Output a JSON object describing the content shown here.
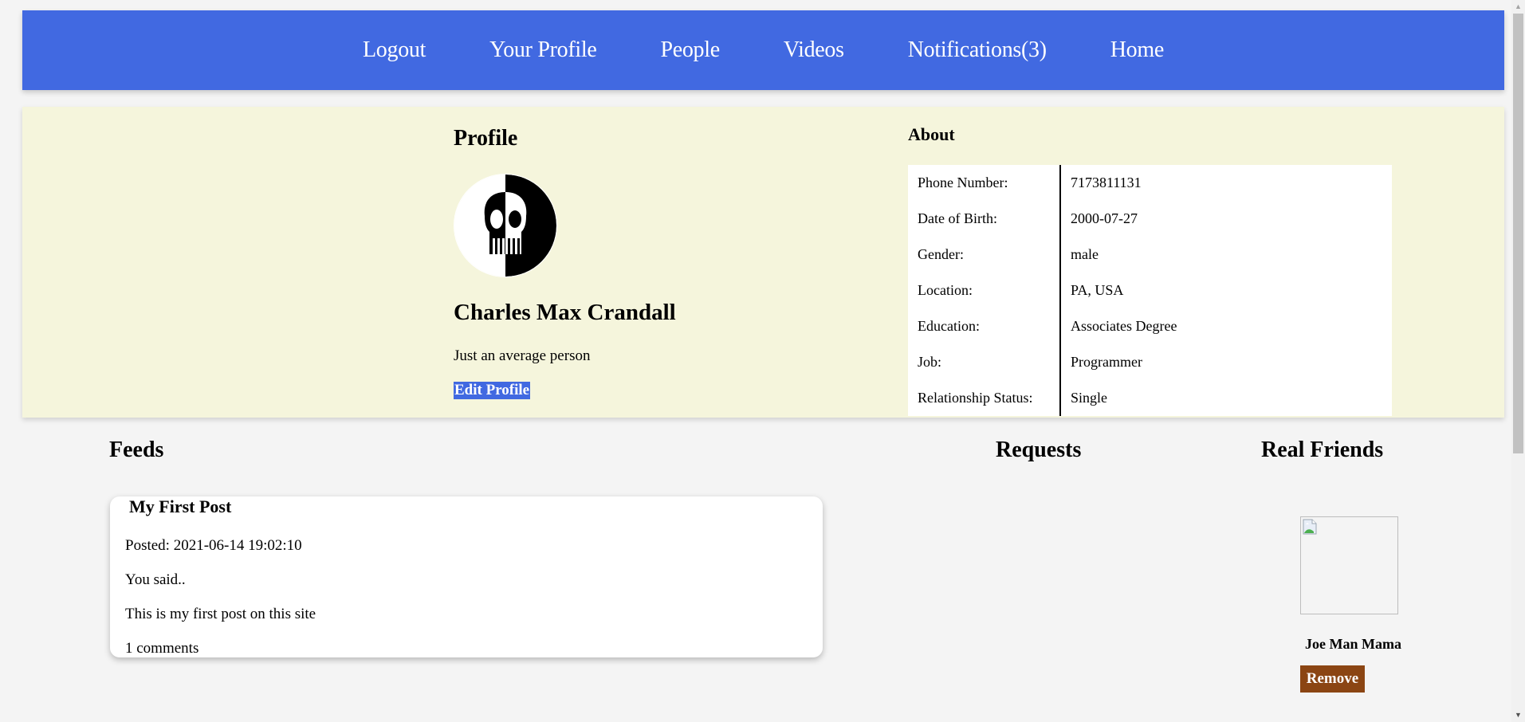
{
  "nav": {
    "items": [
      {
        "label": "Logout"
      },
      {
        "label": "Your Profile"
      },
      {
        "label": "People"
      },
      {
        "label": "Videos"
      },
      {
        "label": "Notifications(3)"
      },
      {
        "label": "Home"
      }
    ]
  },
  "profile": {
    "heading": "Profile",
    "avatar_icon": "skull-avatar",
    "name": "Charles Max Crandall",
    "bio": "Just an average person",
    "edit_label": "Edit Profile"
  },
  "about": {
    "heading": "About",
    "rows": [
      {
        "label": "Phone Number:",
        "value": "7173811131"
      },
      {
        "label": "Date of Birth:",
        "value": "2000-07-27"
      },
      {
        "label": "Gender:",
        "value": "male"
      },
      {
        "label": "Location:",
        "value": "PA, USA"
      },
      {
        "label": "Education:",
        "value": "Associates Degree"
      },
      {
        "label": "Job:",
        "value": "Programmer"
      },
      {
        "label": "Relationship Status:",
        "value": "Single"
      }
    ]
  },
  "feeds": {
    "heading": "Feeds",
    "posts": [
      {
        "title": "My First Post",
        "posted": "Posted: 2021-06-14 19:02:10",
        "intro": "You said..",
        "body": "This is my first post on this site",
        "comments": "1 comments"
      }
    ]
  },
  "requests": {
    "heading": "Requests"
  },
  "friends": {
    "heading": "Real Friends",
    "list": [
      {
        "name": "Joe Man Mama",
        "image_icon": "broken-image-icon",
        "remove_label": "Remove"
      }
    ]
  },
  "colors": {
    "nav_bg": "#4169e1",
    "profile_bg": "#f5f5dc",
    "remove_bg": "#8b4513"
  }
}
